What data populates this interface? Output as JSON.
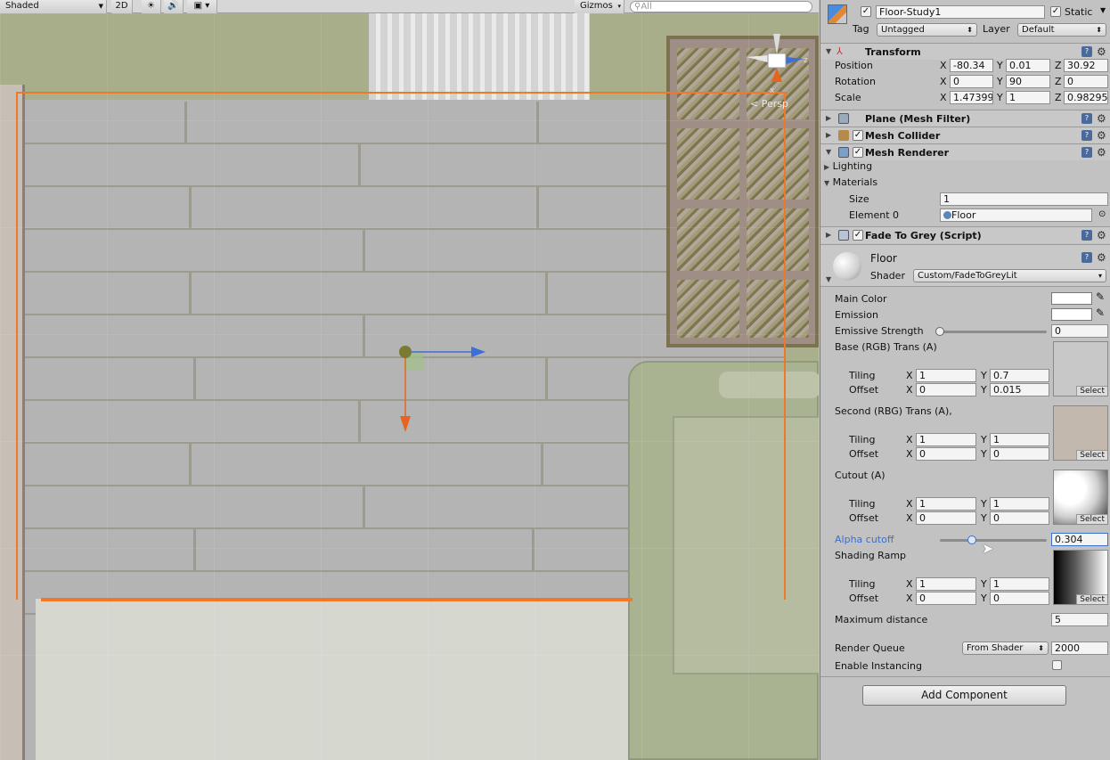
{
  "scene_toolbar": {
    "draw_mode": "Shaded",
    "mode_2d": "2D",
    "gizmos": "Gizmos",
    "search_placeholder": "All",
    "persp": "Persp"
  },
  "gizmo_axes": {
    "x": "x",
    "y": "y",
    "z": "z"
  },
  "object": {
    "name": "Floor-Study1",
    "static_label": "Static",
    "tag_label": "Tag",
    "tag_value": "Untagged",
    "layer_label": "Layer",
    "layer_value": "Default"
  },
  "transform": {
    "title": "Transform",
    "position_label": "Position",
    "rotation_label": "Rotation",
    "scale_label": "Scale",
    "position": {
      "x": "-80.34",
      "y": "0.01",
      "z": "30.92"
    },
    "rotation": {
      "x": "0",
      "y": "90",
      "z": "0"
    },
    "scale": {
      "x": "1.47399",
      "y": "1",
      "z": "0.98295"
    }
  },
  "components": {
    "mesh_filter": "Plane (Mesh Filter)",
    "mesh_collider": "Mesh Collider",
    "mesh_renderer": "Mesh Renderer",
    "lighting": "Lighting",
    "materials": "Materials",
    "size_label": "Size",
    "size_value": "1",
    "element0_label": "Element 0",
    "element0_value": "Floor",
    "fade_script": "Fade To Grey (Script)"
  },
  "material": {
    "name": "Floor",
    "shader_label": "Shader",
    "shader_value": "Custom/FadeToGreyLit",
    "main_color": "Main Color",
    "emission": "Emission",
    "emissive_strength": "Emissive Strength",
    "emissive_value": "0",
    "emissive_fraction": 0,
    "base_tex": "Base (RGB) Trans (A)",
    "second_tex": "Second (RBG) Trans (A),",
    "cutout_tex": "Cutout (A)",
    "tiling": "Tiling",
    "offset": "Offset",
    "select": "Select",
    "x": "X",
    "y": "Y",
    "base_tiling": {
      "x": "1",
      "y": "0.7"
    },
    "base_offset": {
      "x": "0",
      "y": "0.015"
    },
    "second_tiling": {
      "x": "1",
      "y": "1"
    },
    "second_offset": {
      "x": "0",
      "y": "0"
    },
    "cutout_tiling": {
      "x": "1",
      "y": "1"
    },
    "cutout_offset": {
      "x": "0",
      "y": "0"
    },
    "alpha_cutoff": "Alpha cutoff",
    "alpha_value": "0.304",
    "alpha_fraction": 0.304,
    "shading_ramp": "Shading Ramp",
    "ramp_tiling": {
      "x": "1",
      "y": "1"
    },
    "ramp_offset": {
      "x": "0",
      "y": "0"
    },
    "max_distance_label": "Maximum distance",
    "max_distance_value": "5",
    "render_queue_label": "Render Queue",
    "render_queue_mode": "From Shader",
    "render_queue_value": "2000",
    "instancing_label": "Enable Instancing"
  },
  "add_component": "Add Component",
  "colors": {
    "selection": "#f07828",
    "alpha_label": "#3b6fcf",
    "base_tex": "#c8c8c8",
    "second_tex": "#c2b8ad"
  }
}
